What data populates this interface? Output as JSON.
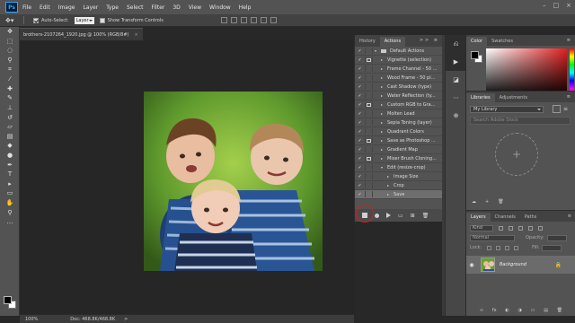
{
  "menubar": {
    "logo": "Ps",
    "items": [
      "File",
      "Edit",
      "Image",
      "Layer",
      "Type",
      "Select",
      "Filter",
      "3D",
      "View",
      "Window",
      "Help"
    ],
    "window_controls": [
      "–",
      "□",
      "×"
    ]
  },
  "options": {
    "auto_select_label": "Auto-Select:",
    "auto_select_value": "Layer",
    "transform_label": "Show Transform Controls"
  },
  "document": {
    "tab_title": "brothers-2107264_1920.jpg @ 100% (RGB/8#)",
    "close_glyph": "×"
  },
  "status": {
    "zoom": "100%",
    "doc_info": "Doc: 468.8K/468.8K",
    "arrow": ">"
  },
  "actions_panel": {
    "tabs": [
      "History",
      "Actions"
    ],
    "active_tab": "Actions",
    "tab_extra": ">> ≡",
    "rows": [
      {
        "label": "Default Actions",
        "check": "✓",
        "dialog": false,
        "expanded": true,
        "folder": true,
        "indent": 0
      },
      {
        "label": "Vignette (selection)",
        "check": "✓",
        "dialog": true,
        "expanded": false,
        "folder": false,
        "indent": 1
      },
      {
        "label": "Frame Channel - 50 ...",
        "check": "✓",
        "dialog": false,
        "expanded": false,
        "folder": false,
        "indent": 1
      },
      {
        "label": "Wood Frame - 50 pi...",
        "check": "✓",
        "dialog": false,
        "expanded": false,
        "folder": false,
        "indent": 1
      },
      {
        "label": "Cast Shadow (type)",
        "check": "✓",
        "dialog": false,
        "expanded": false,
        "folder": false,
        "indent": 1
      },
      {
        "label": "Water Reflection (ty...",
        "check": "✓",
        "dialog": false,
        "expanded": false,
        "folder": false,
        "indent": 1
      },
      {
        "label": "Custom RGB to Gra...",
        "check": "✓",
        "dialog": true,
        "expanded": false,
        "folder": false,
        "indent": 1
      },
      {
        "label": "Molten Lead",
        "check": "✓",
        "dialog": false,
        "expanded": false,
        "folder": false,
        "indent": 1
      },
      {
        "label": "Sepia Toning (layer)",
        "check": "✓",
        "dialog": false,
        "expanded": false,
        "folder": false,
        "indent": 1
      },
      {
        "label": "Quadrant Colors",
        "check": "✓",
        "dialog": false,
        "expanded": false,
        "folder": false,
        "indent": 1
      },
      {
        "label": "Save as Photoshop ...",
        "check": "✓",
        "dialog": true,
        "expanded": false,
        "folder": false,
        "indent": 1
      },
      {
        "label": "Gradient Map",
        "check": "✓",
        "dialog": false,
        "expanded": false,
        "folder": false,
        "indent": 1
      },
      {
        "label": "Mixer Brush Cloning...",
        "check": "✓",
        "dialog": true,
        "expanded": false,
        "folder": false,
        "indent": 1
      },
      {
        "label": "Edit (resize-crop)",
        "check": "✓",
        "dialog": false,
        "expanded": true,
        "folder": false,
        "indent": 1
      },
      {
        "label": "Image Size",
        "check": "✓",
        "dialog": false,
        "expanded": false,
        "folder": false,
        "indent": 2
      },
      {
        "label": "Crop",
        "check": "✓",
        "dialog": false,
        "expanded": false,
        "folder": false,
        "indent": 2
      },
      {
        "label": "Save",
        "check": "✓",
        "dialog": false,
        "expanded": false,
        "folder": false,
        "indent": 2,
        "selected": true
      }
    ]
  },
  "color_panel": {
    "tabs": [
      "Color",
      "Swatches"
    ],
    "tab_extra": "≡"
  },
  "libraries_panel": {
    "tabs": [
      "Libraries",
      "Adjustments"
    ],
    "tab_extra": "≡",
    "library_name": "My Library",
    "search_placeholder": "Search Adobe Stock",
    "add_glyph": "+"
  },
  "layers_panel": {
    "tabs": [
      "Layers",
      "Channels",
      "Paths"
    ],
    "tab_extra": "≡",
    "kind_label": "Kind",
    "blend_mode": "Normal",
    "opacity_label": "Opacity:",
    "lock_label": "Lock:",
    "fill_label": "Fill:",
    "layer_name": "Background",
    "bottom_icons": [
      "∞",
      "fx",
      "◐",
      "◑",
      "▭",
      "▤",
      "🗑"
    ]
  }
}
